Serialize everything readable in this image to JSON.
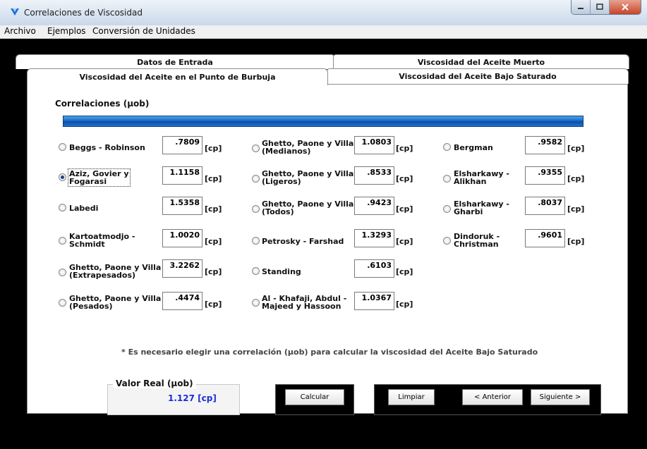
{
  "window": {
    "title": "Correlaciones de Viscosidad"
  },
  "menu": [
    "Archivo",
    "Ejemplos",
    "Conversión de Unidades"
  ],
  "tabs": {
    "back_left": "Datos de Entrada",
    "back_right": "Viscosidad del Aceite Muerto",
    "front_active": "Viscosidad del Aceite en el Punto de Burbuja",
    "front_right": "Viscosidad del Aceite Bajo Saturado"
  },
  "group_title": "Correlaciones  (µob)",
  "unit_label": "[cp]",
  "correlations": [
    {
      "label": "Beggs - Robinson",
      "value": ".7809",
      "selected": false
    },
    {
      "label": "Aziz, Govier y\nFogarasi",
      "value": "1.1158",
      "selected": true
    },
    {
      "label": "Labedi",
      "value": "1.5358",
      "selected": false
    },
    {
      "label": "Kartoatmodjo -\nSchmidt",
      "value": "1.0020",
      "selected": false
    },
    {
      "label": "Ghetto, Paone  y Villa\n(Extrapesados)",
      "value": "3.2262",
      "selected": false
    },
    {
      "label": "Ghetto, Paone y Villa\n(Pesados)",
      "value": ".4474",
      "selected": false
    },
    {
      "label": "Ghetto, Paone y Villa\n(Medianos)",
      "value": "1.0803",
      "selected": false
    },
    {
      "label": "Ghetto, Paone y Villa\n(Ligeros)",
      "value": ".8533",
      "selected": false
    },
    {
      "label": "Ghetto, Paone y Villa\n(Todos)",
      "value": ".9423",
      "selected": false
    },
    {
      "label": "Petrosky - Farshad",
      "value": "1.3293",
      "selected": false
    },
    {
      "label": "Standing",
      "value": ".6103",
      "selected": false
    },
    {
      "label": "Al - Khafaji, Abdul -\nMajeed y Hassoon",
      "value": "1.0367",
      "selected": false
    },
    {
      "label": "Bergman",
      "value": ".9582",
      "selected": false
    },
    {
      "label": "Elsharkawy -\nAlikhan",
      "value": ".9355",
      "selected": false
    },
    {
      "label": "Elsharkawy -\nGharbi",
      "value": ".8037",
      "selected": false
    },
    {
      "label": "Dindoruk -\nChristman",
      "value": ".9601",
      "selected": false
    }
  ],
  "note": "* Es necesario elegir una correlación (µob) para calcular la viscosidad del Aceite Bajo Saturado",
  "real_value": {
    "title": "Valor Real  (µob)",
    "value": "1.127 [cp]"
  },
  "buttons": {
    "calcular": "Calcular",
    "limpiar": "Limpiar",
    "anterior": "< Anterior",
    "siguiente": "Siguiente >"
  },
  "icons": {
    "app": "app-icon",
    "minimize": "minimize-icon",
    "maximize": "maximize-icon",
    "close": "close-icon"
  }
}
